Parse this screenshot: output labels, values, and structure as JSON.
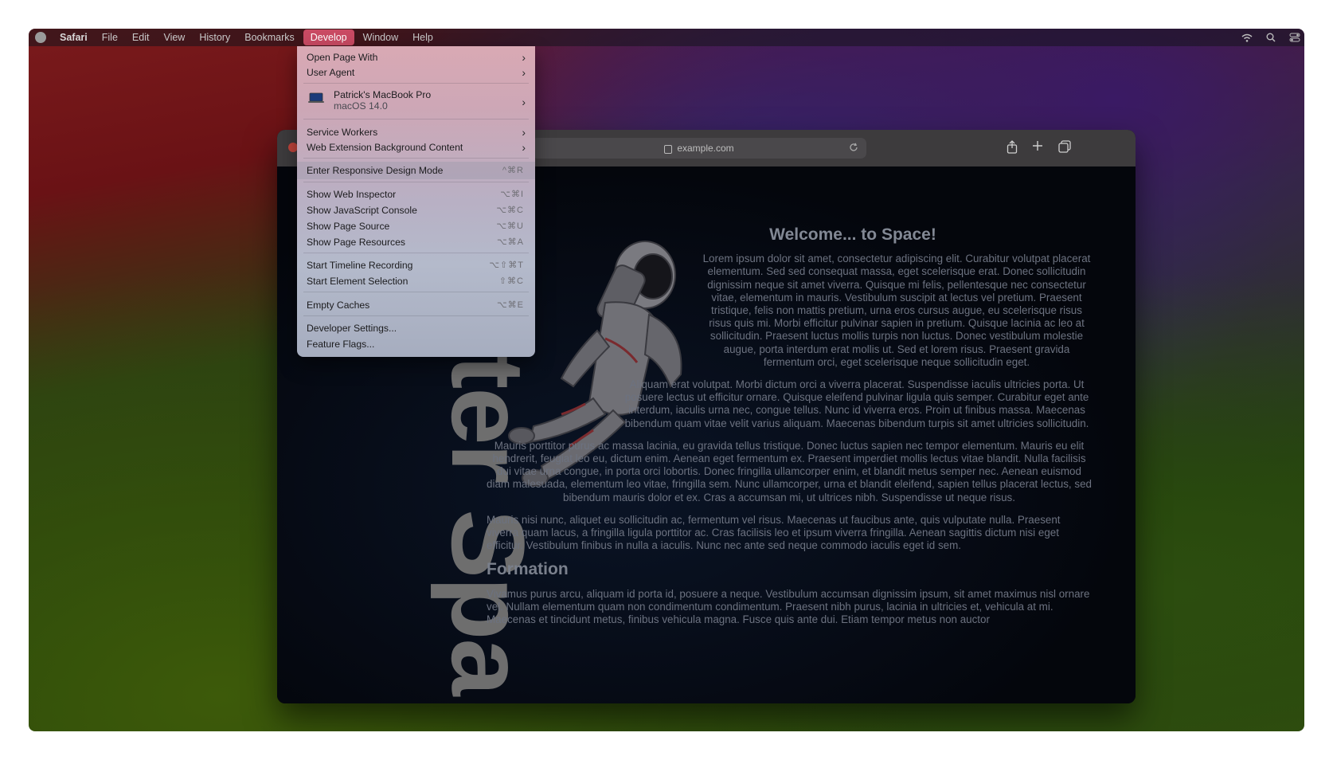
{
  "menubar": {
    "app": "Safari",
    "items": [
      "File",
      "Edit",
      "View",
      "History",
      "Bookmarks",
      "Develop",
      "Window",
      "Help"
    ],
    "active": "Develop"
  },
  "browser": {
    "url": "example.com"
  },
  "develop_menu": {
    "open_page_with": "Open Page With",
    "user_agent": "User Agent",
    "device_name": "Patrick's MacBook Pro",
    "device_os": "macOS 14.0",
    "service_workers": "Service Workers",
    "web_extension_bg": "Web Extension Background Content",
    "responsive_mode": "Enter Responsive Design Mode",
    "responsive_mode_sc": "^⌘R",
    "web_inspector": "Show Web Inspector",
    "web_inspector_sc": "⌥⌘I",
    "js_console": "Show JavaScript Console",
    "js_console_sc": "⌥⌘C",
    "page_source": "Show Page Source",
    "page_source_sc": "⌥⌘U",
    "page_resources": "Show Page Resources",
    "page_resources_sc": "⌥⌘A",
    "timeline": "Start Timeline Recording",
    "timeline_sc": "⌥⇧⌘T",
    "element_selection": "Start Element Selection",
    "element_selection_sc": "⇧⌘C",
    "empty_caches": "Empty Caches",
    "empty_caches_sc": "⌥⌘E",
    "developer_settings": "Developer Settings...",
    "feature_flags": "Feature Flags..."
  },
  "page": {
    "vertical_title": "ter Spa",
    "heading": "Welcome... to Space!",
    "p1": "Lorem ipsum dolor sit amet, consectetur adipiscing elit. Curabitur volutpat placerat elementum. Sed sed consequat massa, eget scelerisque erat. Donec sollicitudin dignissim neque sit amet viverra. Quisque mi felis, pellentesque nec consectetur vitae, elementum in mauris. Vestibulum suscipit at lectus vel pretium. Praesent tristique, felis non mattis pretium, urna eros cursus augue, eu scelerisque risus risus quis mi. Morbi efficitur pulvinar sapien in pretium. Quisque lacinia ac leo at sollicitudin. Praesent luctus mollis turpis non luctus. Donec vestibulum molestie augue, porta interdum erat mollis ut. Sed et lorem risus. Praesent gravida fermentum orci, eget scelerisque neque sollicitudin eget.",
    "p2": "Aliquam erat volutpat. Morbi dictum orci a viverra placerat. Suspendisse iaculis ultricies porta. Ut posuere lectus ut efficitur ornare. Quisque eleifend pulvinar ligula quis semper. Curabitur eget ante interdum, iaculis urna nec, congue tellus. Nunc id viverra eros. Proin ut finibus massa. Maecenas bibendum quam vitae velit varius aliquam. Maecenas bibendum turpis sit amet ultricies sollicitudin.",
    "p3": "Mauris porttitor purus ac massa lacinia, eu gravida tellus tristique. Donec luctus sapien nec tempor elementum. Mauris eu elit hendrerit, feugiat leo eu, dictum enim. Aenean eget fermentum ex. Praesent imperdiet mollis lectus vitae blandit. Nulla facilisis dui vitae urna congue, in porta orci lobortis. Donec fringilla ullamcorper enim, et blandit metus semper nec. Aenean euismod diam malesuada, elementum leo vitae, fringilla sem. Nunc ullamcorper, urna et blandit eleifend, sapien tellus placerat lectus, sed bibendum mauris dolor et ex. Cras a accumsan mi, ut ultrices nibh. Suspendisse ut neque risus.",
    "p4": "Mauris nisi nunc, aliquet eu sollicitudin ac, fermentum vel risus. Maecenas ut faucibus ante, quis vulputate nulla. Praesent viverra quam lacus, a fringilla ligula porttitor ac. Cras facilisis leo et ipsum viverra fringilla. Aenean sagittis dictum nisi eget efficitur. Vestibulum finibus in nulla a iaculis. Nunc nec ante sed neque commodo iaculis eget id sem.",
    "subheading": "Formation",
    "p5": "Vivamus purus arcu, aliquam id porta id, posuere a neque. Vestibulum accumsan dignissim ipsum, sit amet maximus nisl ornare vel. Nullam elementum quam non condimentum condimentum. Praesent nibh purus, lacinia in ultricies et, vehicula at mi. Maecenas et tincidunt metus, finibus vehicula magna. Fusce quis ante dui. Etiam tempor metus non auctor"
  },
  "icons": {
    "wifi": "wifi-icon",
    "search": "spotlight-search-icon",
    "control_center": "control-center-icon",
    "share": "share-icon",
    "new_tab": "new-tab-icon",
    "tabs": "tab-overview-icon",
    "reload": "reload-icon",
    "lock": "lock-icon",
    "laptop": "laptop-icon"
  },
  "colors": {
    "menu_highlight": "#c94a63",
    "close_button": "#c1443b"
  }
}
